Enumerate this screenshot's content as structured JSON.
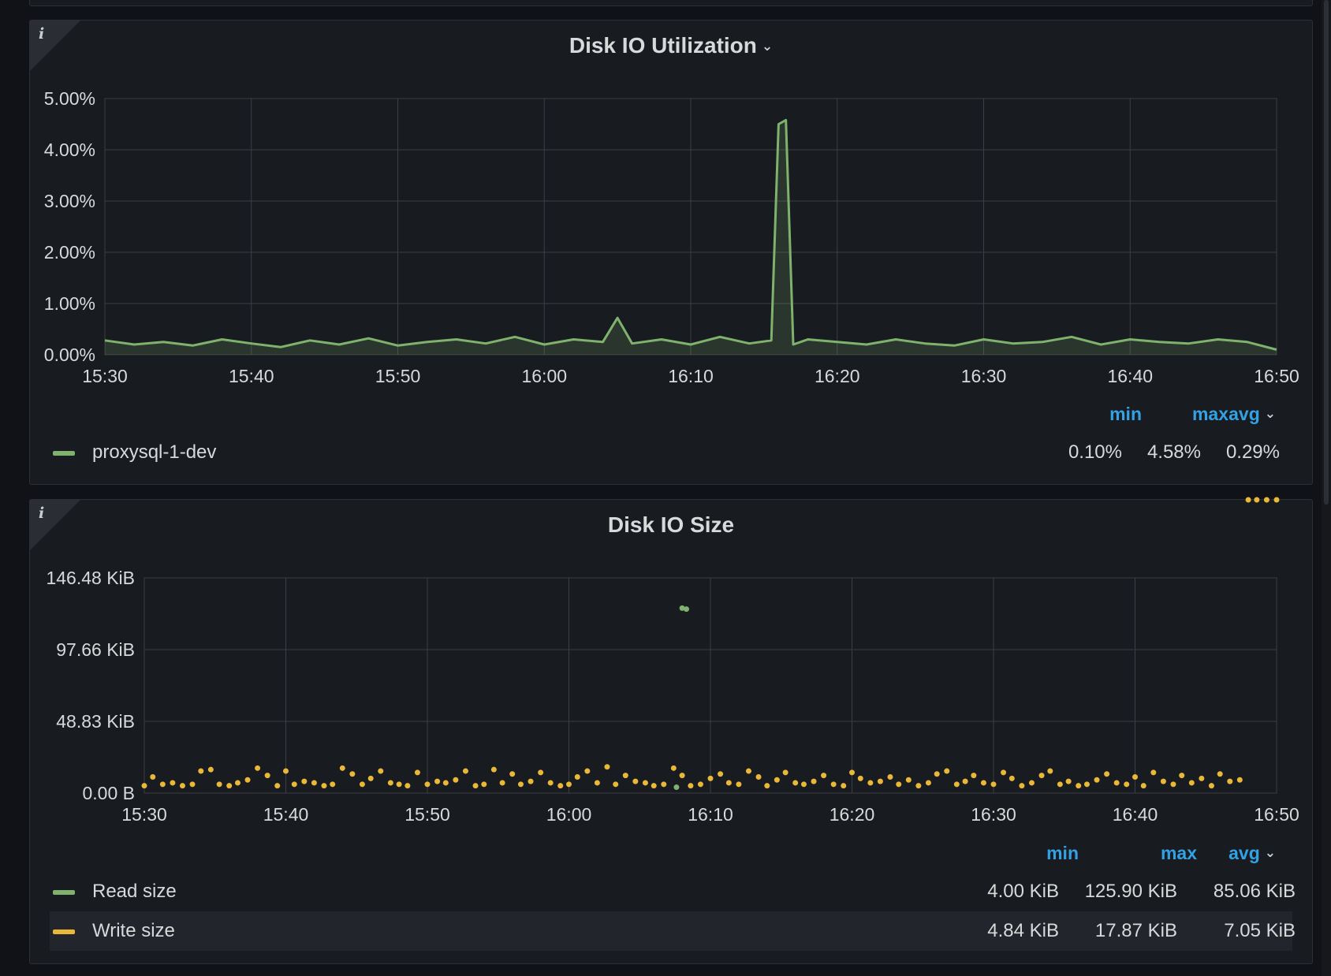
{
  "colors": {
    "read": "#7eb26d",
    "write": "#eab839",
    "utilization": "#7eb26d",
    "grid": "#3b3e45",
    "accent": "#33a2e5"
  },
  "icons": {
    "info": "i",
    "chevron": "⌄"
  },
  "panels": [
    {
      "title": "Disk IO Utilization",
      "legend": {
        "headers": [
          "min",
          "max",
          "avg"
        ],
        "rows": [
          {
            "name": "proxysql-1-dev",
            "values": [
              "0.10%",
              "4.58%",
              "0.29%"
            ]
          }
        ]
      }
    },
    {
      "title": "Disk IO Size",
      "legend": {
        "headers": [
          "min",
          "max",
          "avg"
        ],
        "rows": [
          {
            "name": "Read size",
            "values": [
              "4.00 KiB",
              "125.90 KiB",
              "85.06 KiB"
            ]
          },
          {
            "name": "Write size",
            "values": [
              "4.84 KiB",
              "17.87 KiB",
              "7.05 KiB"
            ]
          }
        ]
      }
    }
  ],
  "chart_data": [
    {
      "type": "area",
      "title": "Disk IO Utilization",
      "xlabel": "",
      "ylabel": "",
      "x_ticks": [
        "15:30",
        "15:40",
        "15:50",
        "16:00",
        "16:10",
        "16:20",
        "16:30",
        "16:40",
        "16:50"
      ],
      "y_ticks": [
        "0.00%",
        "1.00%",
        "2.00%",
        "3.00%",
        "4.00%",
        "5.00%"
      ],
      "x_range_min": [
        0,
        80
      ],
      "ylim": [
        0,
        5
      ],
      "grid": true,
      "legend_position": "bottom",
      "series": [
        {
          "name": "proxysql-1-dev",
          "x_min": [
            0,
            2,
            4,
            6,
            8,
            10,
            12,
            14,
            16,
            18,
            20,
            22,
            24,
            26,
            28,
            30,
            32,
            34,
            35,
            36,
            38,
            40,
            42,
            44,
            45.5,
            46,
            46.5,
            47,
            48,
            50,
            52,
            54,
            56,
            58,
            60,
            62,
            64,
            66,
            68,
            70,
            72,
            74,
            76,
            78,
            80
          ],
          "values": [
            0.28,
            0.2,
            0.25,
            0.18,
            0.3,
            0.22,
            0.15,
            0.28,
            0.2,
            0.32,
            0.18,
            0.25,
            0.3,
            0.22,
            0.35,
            0.2,
            0.3,
            0.25,
            0.72,
            0.22,
            0.3,
            0.2,
            0.35,
            0.22,
            0.28,
            4.5,
            4.58,
            0.2,
            0.3,
            0.25,
            0.2,
            0.3,
            0.22,
            0.18,
            0.3,
            0.22,
            0.25,
            0.35,
            0.2,
            0.3,
            0.25,
            0.22,
            0.3,
            0.25,
            0.1
          ]
        }
      ]
    },
    {
      "type": "scatter",
      "title": "Disk IO Size",
      "xlabel": "",
      "ylabel": "",
      "x_ticks": [
        "15:30",
        "15:40",
        "15:50",
        "16:00",
        "16:10",
        "16:20",
        "16:30",
        "16:40",
        "16:50"
      ],
      "y_ticks": [
        "0.00 B",
        "48.83 KiB",
        "97.66 KiB",
        "146.48 KiB"
      ],
      "x_range_min": [
        0,
        80
      ],
      "ylim": [
        0,
        146.48
      ],
      "grid": true,
      "legend_position": "bottom",
      "series": [
        {
          "name": "Read size",
          "x_min": [
            38,
            38.3,
            37.6
          ],
          "values": [
            125.9,
            125.2,
            4.0
          ]
        },
        {
          "name": "Write size",
          "x_min": [
            0,
            0.6,
            1.3,
            2,
            2.7,
            3.4,
            4,
            4.7,
            5.3,
            6,
            6.6,
            7.3,
            8,
            8.7,
            9.4,
            10,
            10.6,
            11.3,
            12,
            12.7,
            13.3,
            14,
            14.7,
            15.4,
            16,
            16.7,
            17.4,
            18,
            18.6,
            19.3,
            20,
            20.7,
            21.3,
            22,
            22.7,
            23.4,
            24,
            24.7,
            25.3,
            26,
            26.6,
            27.3,
            28,
            28.7,
            29.4,
            30,
            30.6,
            31.3,
            32,
            32.7,
            33.3,
            34,
            34.7,
            35.4,
            36,
            36.7,
            37.4,
            38,
            38.6,
            39.3,
            40,
            40.7,
            41.3,
            42,
            42.7,
            43.4,
            44,
            44.7,
            45.3,
            46,
            46.6,
            47.3,
            48,
            48.7,
            49.4,
            50,
            50.6,
            51.3,
            52,
            52.7,
            53.3,
            54,
            54.7,
            55.4,
            56,
            56.7,
            57.4,
            58,
            58.6,
            59.3,
            60,
            60.7,
            61.3,
            62,
            62.7,
            63.4,
            64,
            64.7,
            65.3,
            66,
            66.6,
            67.3,
            68,
            68.7,
            69.4,
            70,
            70.6,
            71.3,
            72,
            72.7,
            73.3,
            74,
            74.7,
            75.4,
            76,
            76.7,
            77.4,
            78,
            78.6,
            79.3,
            80
          ],
          "values": [
            5,
            11,
            6,
            7,
            5,
            6,
            15,
            16,
            6,
            5,
            7,
            9,
            17,
            12,
            5,
            15,
            6,
            8,
            7,
            5,
            6,
            17,
            13,
            6,
            10,
            15,
            7,
            6,
            5,
            14,
            6,
            8,
            7,
            9,
            15,
            5,
            6,
            16,
            7,
            13,
            6,
            8,
            14,
            7,
            5,
            6,
            11,
            15,
            7,
            17.87,
            6,
            12,
            8,
            7,
            5,
            6,
            17,
            12,
            5,
            6,
            10,
            13,
            7,
            6,
            15,
            11,
            5,
            9,
            14,
            7,
            6,
            8,
            12,
            6,
            5,
            14,
            10,
            7,
            8,
            11,
            6,
            9,
            5,
            7,
            13,
            15,
            6,
            8,
            12,
            7,
            6,
            14,
            10,
            5,
            7,
            12,
            15,
            6,
            8,
            5,
            6,
            9,
            13,
            7,
            6,
            11,
            5,
            14,
            8,
            6,
            12,
            7,
            10,
            5,
            13,
            8,
            9
          ]
        }
      ]
    }
  ]
}
